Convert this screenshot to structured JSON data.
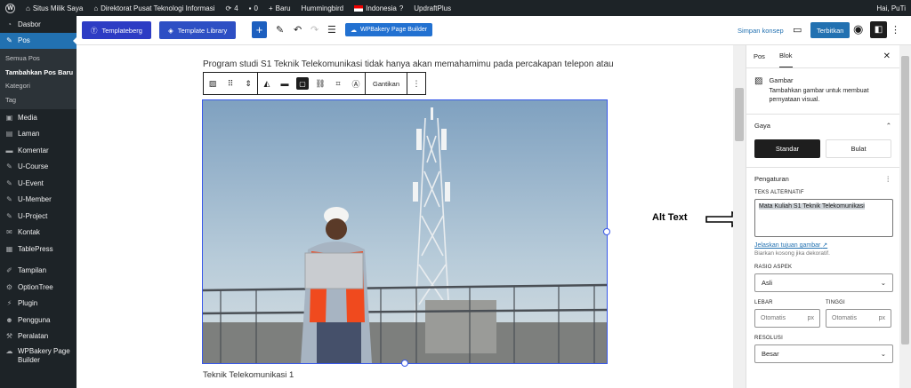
{
  "adminbar": {
    "site": "Situs Milik Saya",
    "directorate": "Direktorat Pusat Teknologi Informasi",
    "updates": "4",
    "comments": "0",
    "new": "Baru",
    "theme": "Hummingbird",
    "language": "Indonesia",
    "updraft": "UpdraftPlus",
    "greeting": "Hai, PuTi"
  },
  "sidebar": {
    "items": [
      {
        "label": "Dasbor",
        "icon": "dashboard-icon"
      },
      {
        "label": "Pos",
        "icon": "pin-icon",
        "active": true
      },
      {
        "label": "Media",
        "icon": "media-icon"
      },
      {
        "label": "Laman",
        "icon": "page-icon"
      },
      {
        "label": "Komentar",
        "icon": "comment-icon"
      },
      {
        "label": "U-Course",
        "icon": "pin-icon"
      },
      {
        "label": "U-Event",
        "icon": "pin-icon"
      },
      {
        "label": "U-Member",
        "icon": "pin-icon"
      },
      {
        "label": "U-Project",
        "icon": "pin-icon"
      },
      {
        "label": "Kontak",
        "icon": "mail-icon"
      },
      {
        "label": "TablePress",
        "icon": "table-icon"
      },
      {
        "label": "Tampilan",
        "icon": "brush-icon"
      },
      {
        "label": "OptionTree",
        "icon": "gear-icon"
      },
      {
        "label": "Plugin",
        "icon": "plugin-icon"
      },
      {
        "label": "Pengguna",
        "icon": "user-icon"
      },
      {
        "label": "Peralatan",
        "icon": "wrench-icon"
      },
      {
        "label": "WPBakery Page Builder",
        "icon": "wpbakery-icon"
      }
    ],
    "submenu": [
      "Semua Pos",
      "Tambahkan Pos Baru",
      "Kategori",
      "Tag"
    ]
  },
  "toolbar": {
    "templateberg": "Templateberg",
    "template_library": "Template Library",
    "wpbakery": "WPBakery Page Builder",
    "save_draft": "Simpan konsep",
    "publish": "Terbitkan"
  },
  "editor": {
    "paragraph": "Program studi S1 Teknik Telekomunikasi tidak hanya akan memahamimu pada percakapan telepon atau",
    "replace": "Gantikan",
    "caption": "Teknik Telekomunikasi 1",
    "annotation": "Alt Text"
  },
  "panel": {
    "tab_post": "Pos",
    "tab_block": "Blok",
    "block_title": "Gambar",
    "block_desc": "Tambahkan gambar untuk membuat pernyataan visual.",
    "styles_title": "Gaya",
    "style_default": "Standar",
    "style_rounded": "Bulat",
    "settings_title": "Pengaturan",
    "alt_label": "TEKS ALTERNATIF",
    "alt_value": "Mata Kuliah S1 Teknik Telekomunikasi",
    "alt_link": "Jelaskan tujuan gambar",
    "alt_help": "Biarkan kosong jika dekoratif.",
    "aspect_label": "RASIO ASPEK",
    "aspect_value": "Asli",
    "width_label": "LEBAR",
    "height_label": "TINGGI",
    "width_placeholder": "Otomatis",
    "height_placeholder": "Otomatis",
    "unit": "px",
    "resolution_label": "RESOLUSI",
    "resolution_value": "Besar"
  }
}
